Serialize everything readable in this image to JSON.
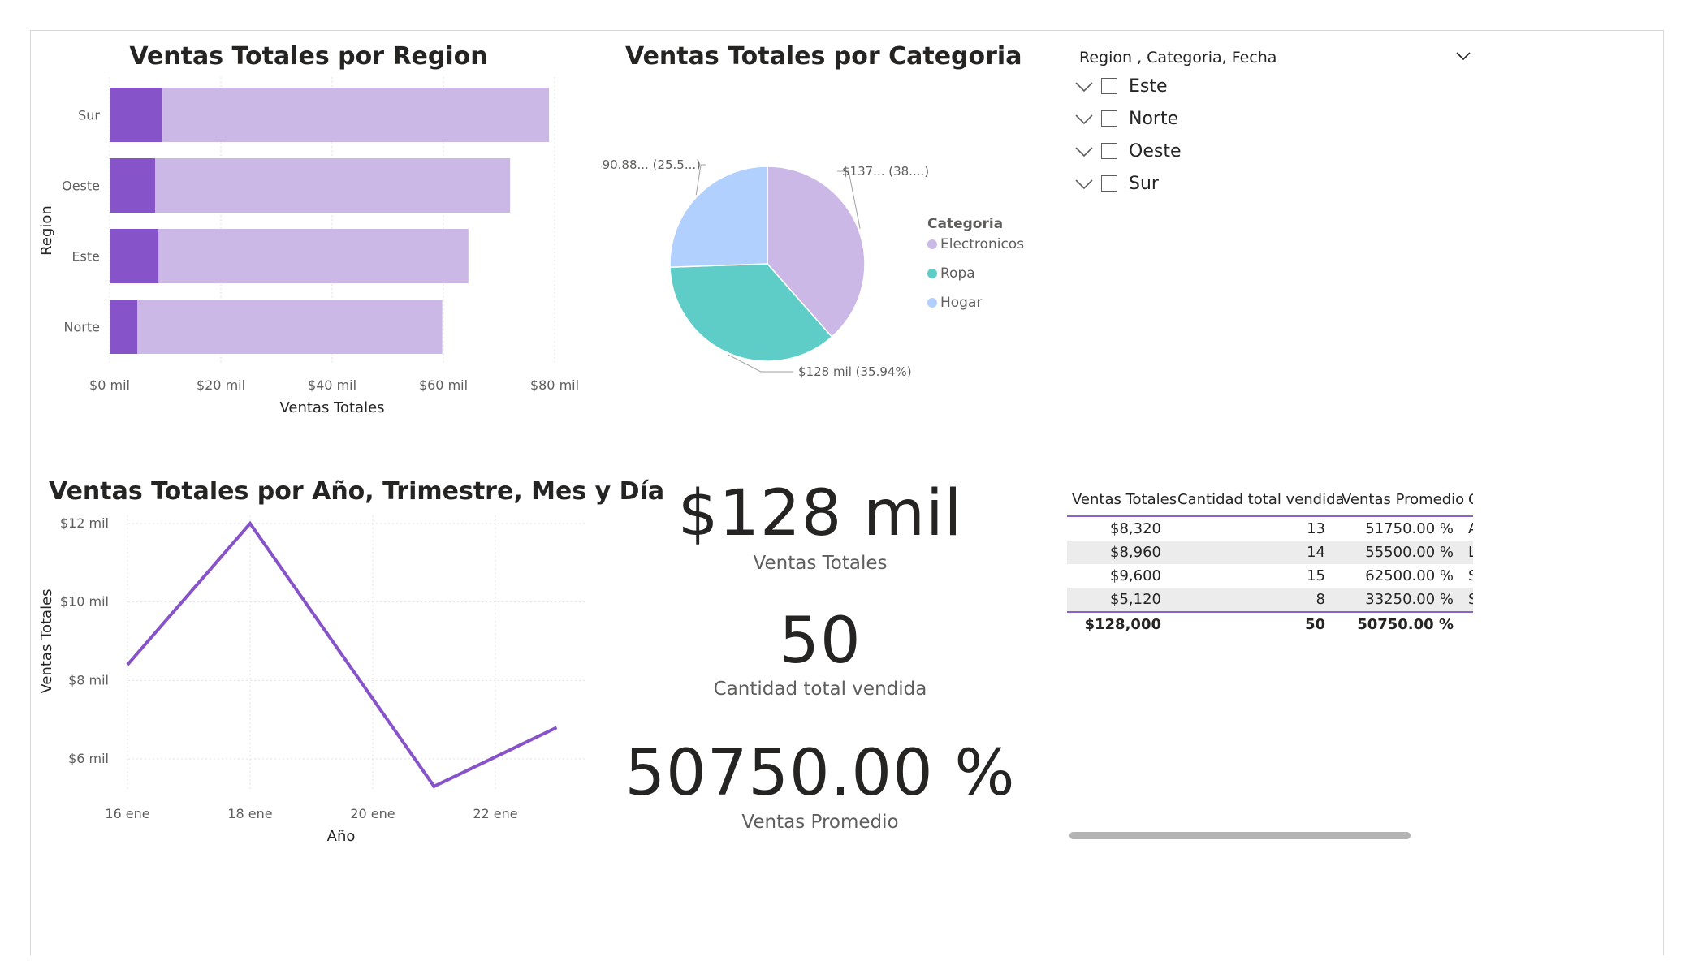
{
  "colors": {
    "bar_dark": "#8753c9",
    "bar_light": "#cbb8e6",
    "line": "#8753c9",
    "pie_electronicos": "#cbb8e6",
    "pie_ropa": "#5ecdc8",
    "pie_hogar": "#b1d0fd",
    "table_accent": "#8a63c8"
  },
  "bar_chart": {
    "title": "Ventas Totales por Region",
    "chart_data": {
      "type": "bar",
      "orientation": "horizontal",
      "categories": [
        "Sur",
        "Oeste",
        "Este",
        "Norte"
      ],
      "series": [
        {
          "values": [
            9.5,
            8.2,
            8.8,
            5.0
          ]
        },
        {
          "values": [
            69.5,
            63.8,
            55.7,
            54.8
          ]
        }
      ],
      "stacked": true,
      "xlabel": "Ventas Totales",
      "ylabel": "Region",
      "xlim": [
        0,
        80
      ],
      "xticks": [
        "$0 mil",
        "$20 mil",
        "$40 mil",
        "$60 mil",
        "$80 mil"
      ],
      "grid": true
    }
  },
  "pie_chart": {
    "title": "Ventas Totales por Categoria",
    "chart_data": {
      "type": "pie",
      "legend_title": "Categoria",
      "categories": [
        "Electronicos",
        "Ropa",
        "Hogar"
      ],
      "values": [
        38.5,
        35.94,
        25.56
      ],
      "data_labels": [
        "$137... (38....)",
        "$128 mil (35.94%)",
        "$90.88... (25.5...)"
      ],
      "legend_placement": "right"
    }
  },
  "line_chart": {
    "title": "Ventas Totales por Año, Trimestre, Mes y Día",
    "chart_data": {
      "type": "line",
      "x": [
        "2024-01-16",
        "2024-01-18",
        "2024-01-21",
        "2024-01-23"
      ],
      "values": [
        8.4,
        12.0,
        5.3,
        6.8
      ],
      "xticks": [
        "16 ene",
        "18 ene",
        "20 ene",
        "22 ene"
      ],
      "yticks": [
        "$12 mil",
        "$10 mil",
        "$8 mil",
        "$6 mil"
      ],
      "ylim": [
        5,
        12
      ],
      "xlabel": "Año",
      "ylabel": "Ventas Totales",
      "grid": true
    }
  },
  "cards": [
    {
      "value": "$128 mil",
      "label": "Ventas Totales"
    },
    {
      "value": "50",
      "label": "Cantidad total vendida"
    },
    {
      "value": "50750.00 %",
      "label": "Ventas Promedio"
    }
  ],
  "slicer": {
    "header": "Region , Categoria, Fecha",
    "items": [
      "Este",
      "Norte",
      "Oeste",
      "Sur"
    ]
  },
  "table": {
    "headers": [
      "Ventas Totales",
      "Cantidad total vendida",
      "Ventas Promedio",
      "C"
    ],
    "rows": [
      [
        "$8,320",
        "13",
        "51750.00 %",
        "A"
      ],
      [
        "$8,960",
        "14",
        "55500.00 %",
        "L"
      ],
      [
        "$9,600",
        "15",
        "62500.00 %",
        "S"
      ],
      [
        "$5,120",
        "8",
        "33250.00 %",
        "S"
      ]
    ],
    "total": [
      "$128,000",
      "50",
      "50750.00 %",
      ""
    ]
  }
}
